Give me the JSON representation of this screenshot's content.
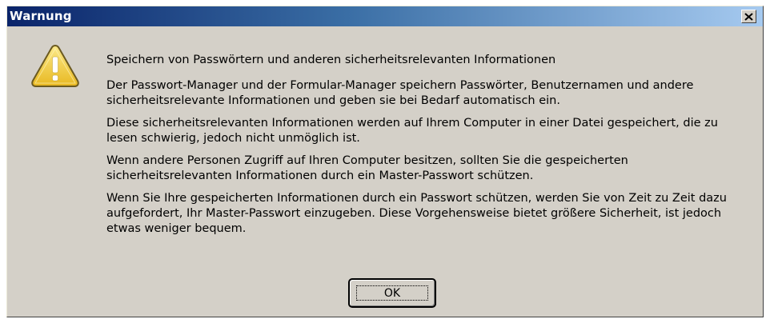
{
  "window": {
    "title": "Warnung",
    "close_icon": "close-icon"
  },
  "icon": {
    "name": "warning-icon",
    "fill_color": "#f3d23a",
    "outline_color": "#6b5a20"
  },
  "messages": {
    "heading": "Speichern von Passwörtern und anderen sicherheitsrelevanten Informationen",
    "paragraphs": [
      "Der Passwort-Manager und der Formular-Manager speichern Passwörter, Benutzernamen und andere sicherheitsrelevante Informationen und geben sie bei Bedarf automatisch ein.",
      "Diese sicherheitsrelevanten Informationen werden auf Ihrem Computer in einer Datei gespeichert, die zu lesen schwierig, jedoch nicht unmöglich ist.",
      "Wenn andere Personen Zugriff auf Ihren Computer besitzen, sollten Sie die gespeicherten sicherheitsrelevanten Informationen durch ein Master-Passwort schützen.",
      "Wenn Sie Ihre gespeicherten Informationen durch ein Passwort schützen, werden Sie von Zeit zu Zeit dazu aufgefordert, Ihr Master-Passwort einzugeben. Diese Vorgehensweise bietet größere Sicherheit, ist jedoch etwas weniger bequem."
    ]
  },
  "buttons": {
    "ok_label": "OK"
  },
  "colors": {
    "titlebar_start": "#0a246a",
    "titlebar_end": "#a6caf0",
    "dialog_face": "#d4d0c8"
  }
}
